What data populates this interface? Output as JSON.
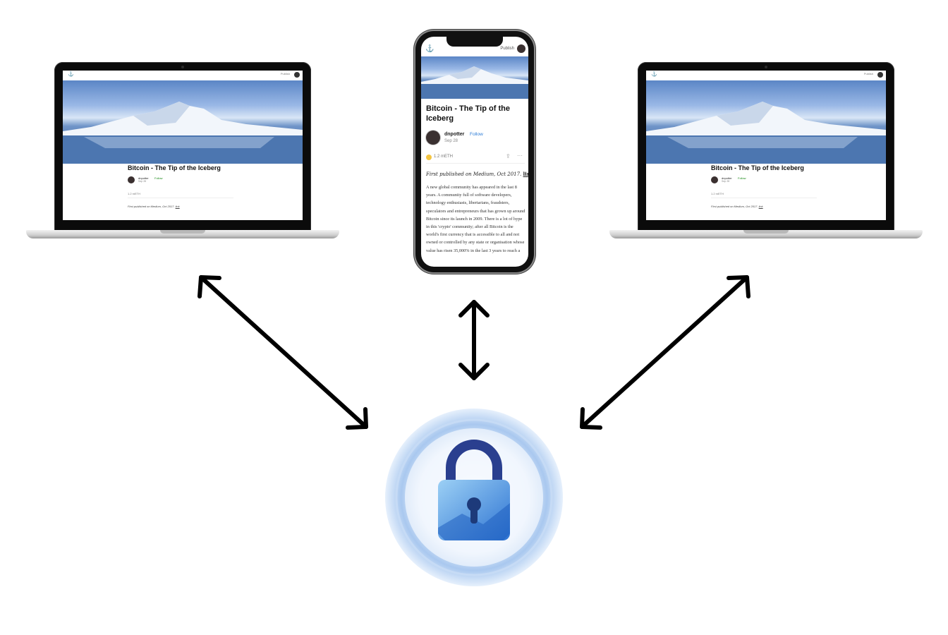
{
  "article": {
    "title": "Bitcoin - The Tip of the Iceberg",
    "author": "dnpotter",
    "follow_label": "Follow",
    "date": "Sep 28",
    "claps": "1.2 mETH",
    "publish_label": "Publish",
    "published_prefix": "First published on Medium, Oct 2017.",
    "published_link": "link",
    "body": "A new global community has appeared in the last 8 years. A community full of software developers, technology enthusiasts, libertarians, fraudsters, speculators and entrepreneurs that has grown up around Bitcoin since its launch in 2009. There is a lot of hype in this 'crypto' community; after all Bitcoin is the world's first currency that is accessible to all and not owned or controlled by any state or organisation whose value has risen 35,000% in the last 3 years to reach a"
  },
  "colors": {
    "arrow": "#000000",
    "lock_blue": "#2f6fd0",
    "lock_shackle": "#2a3f8f",
    "glow": "#dbe9fb"
  },
  "icons": {
    "logo": "anchor-icon",
    "lock": "padlock-icon",
    "clap": "clap-icon",
    "share": "share-icon",
    "more": "more-icon"
  }
}
